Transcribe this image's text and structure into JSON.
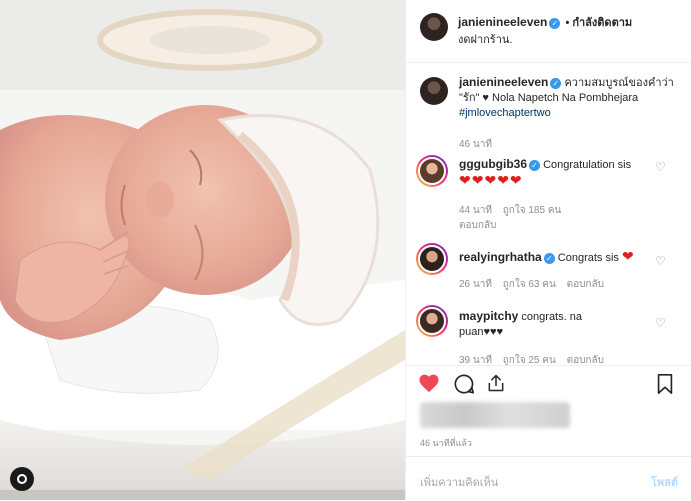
{
  "header": {
    "username": "janienineeleven",
    "follow_status": "• กำลังติดตาม",
    "location": "งดฝากร้าน."
  },
  "caption": {
    "username": "janienineeleven",
    "text_part1": "ความสมบูรณ์ของคำว่า \"รัก\" ♥ Nola Napetch Na Pombhejara",
    "hashtag": "#jmlovechaptertwo",
    "time": "46 นาที"
  },
  "comments": [
    {
      "username": "gggubgib36",
      "text": "Congratulation sis",
      "hearts": "❤❤❤❤❤",
      "time": "44 นาที",
      "likes": "ถูกใจ 185 คน",
      "reply": "ตอบกลับ"
    },
    {
      "username": "realyingrhatha",
      "text": "Congrats sis",
      "hearts": "❤",
      "time": "26 นาที",
      "likes": "ถูกใจ 63 คน",
      "reply": "ตอบกลับ"
    },
    {
      "username": "maypitchy",
      "text": "congrats. na puan♥♥♥",
      "time": "39 นาที",
      "likes": "ถูกใจ 25 คน",
      "reply": "ตอบกลับ"
    }
  ],
  "post_time": "46 นาทีที่แล้ว",
  "add_comment": {
    "placeholder": "เพิ่มความคิดเห็น",
    "post_label": "โพสต์"
  },
  "colors": {
    "like_red": "#ed4956",
    "verified_blue": "#3897f0",
    "link_blue": "#003569"
  },
  "icons": [
    "heart-icon",
    "comment-icon",
    "share-icon",
    "bookmark-icon",
    "verified-icon",
    "like-comment-icon",
    "profile-icon"
  ]
}
